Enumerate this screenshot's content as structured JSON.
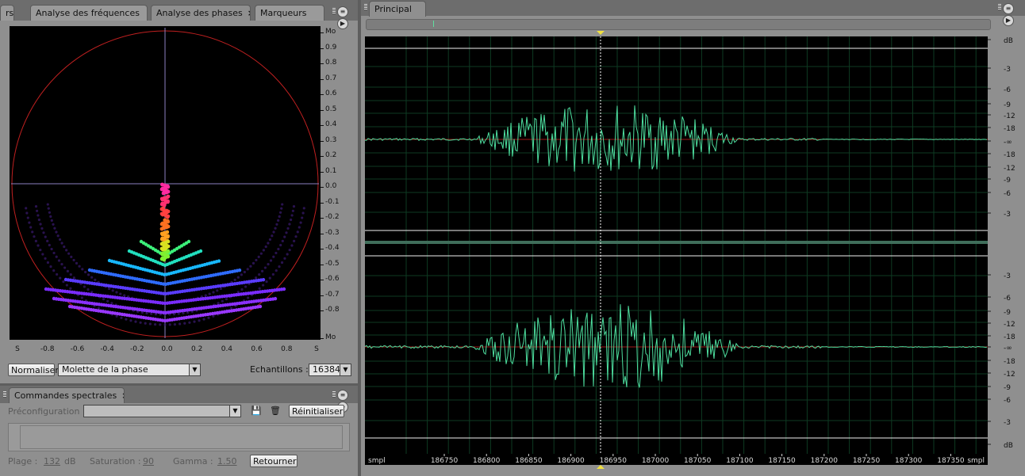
{
  "phase_panel": {
    "tabs": [
      {
        "label": "rs"
      },
      {
        "label": "Analyse des fréquences"
      },
      {
        "label": "Analyse des phases",
        "close": "×"
      },
      {
        "label": "Marqueurs"
      }
    ],
    "y_ticks": [
      "Mo",
      "0.9",
      "0.8",
      "0.7",
      "0.6",
      "0.5",
      "0.4",
      "0.3",
      "0.2",
      "0.1",
      "0.0",
      "-0.1",
      "-0.2",
      "-0.3",
      "-0.4",
      "-0.5",
      "-0.6",
      "-0.7",
      "-0.8",
      "Mo"
    ],
    "x_ticks": [
      "S",
      "-0.8",
      "-0.6",
      "-0.4",
      "-0.2",
      "0.0",
      "0.2",
      "0.4",
      "0.6",
      "0.8",
      "S"
    ],
    "normalize_label": "Normaliser",
    "mode_select": "Molette de la phase",
    "samples_label": "Echantillons :",
    "samples_value": "16384"
  },
  "spectral_panel": {
    "title": "Commandes spectrales",
    "close": "×",
    "preset_label": "Préconfiguration :",
    "preset_value": "",
    "reset_label": "Réinitialiser",
    "range_label": "Plage :",
    "range_value": "132",
    "range_unit": "dB",
    "saturation_label": "Saturation :",
    "saturation_value": "90",
    "gamma_label": "Gamma :",
    "gamma_value": "1.50",
    "return_label": "Retourner"
  },
  "main_panel": {
    "tab_label": "Principal",
    "db_ticks_top": [
      "dB",
      "-3",
      "-6",
      "-9",
      "-12",
      "-18",
      "-∞",
      "-18",
      "-12",
      "-9",
      "-6",
      "-3"
    ],
    "db_ticks_bottom": [
      "-3",
      "-6",
      "-9",
      "-12",
      "-18",
      "-∞",
      "-18",
      "-12",
      "-9",
      "-6",
      "-3",
      "dB"
    ],
    "time_unit_left": "smpl",
    "time_unit_right": "smpl",
    "time_ticks": [
      "186750",
      "186800",
      "186850",
      "186900",
      "186950",
      "187000",
      "187050",
      "187100",
      "187150",
      "187200",
      "187250",
      "187300",
      "187350"
    ]
  },
  "colors": {
    "waveform": "#4ee0a0",
    "cursor": "#f0e040",
    "grid": "#0e3a22",
    "circle": "#c02020"
  }
}
